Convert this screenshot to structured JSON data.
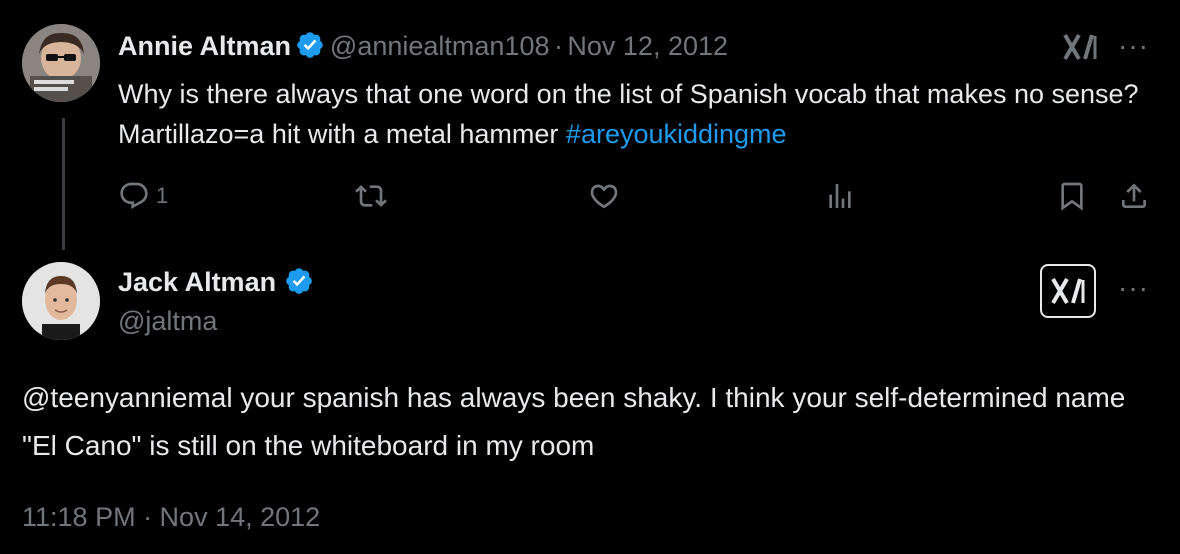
{
  "tweet1": {
    "name": "Annie Altman",
    "handle": "@anniealtman108",
    "separator": "·",
    "date": "Nov 12, 2012",
    "text": "Why is there always that one word on the list of Spanish vocab that makes no sense? Martillazo=a hit with a metal hammer ",
    "hashtag": "#areyoukiddingme",
    "reply_count": "1",
    "more_label": "···"
  },
  "tweet2": {
    "name": "Jack Altman",
    "handle": "@jaltma",
    "text": "@teenyanniemal your spanish has always been shaky. I think your self-determined name \"El Cano\" is still on the whiteboard in my room",
    "timestamp": "11:18 PM · Nov 14, 2012",
    "more_label": "···"
  },
  "colors": {
    "background": "#000000",
    "text": "#e7e9ea",
    "secondary": "#71767b",
    "link": "#1d9bf0",
    "verified": "#1d9bf0"
  },
  "icons": [
    "verified-badge-icon",
    "grok-icon",
    "more-icon",
    "reply-icon",
    "retweet-icon",
    "like-icon",
    "views-icon",
    "bookmark-icon",
    "share-icon"
  ]
}
